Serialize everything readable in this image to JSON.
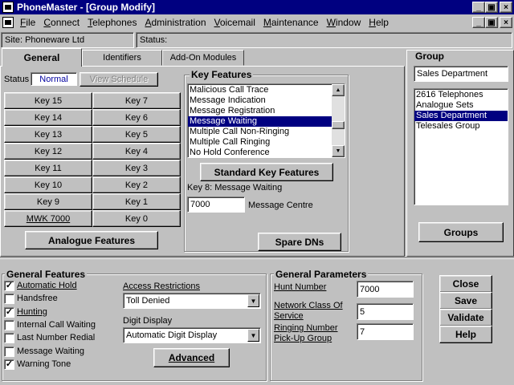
{
  "window": {
    "title": "PhoneMaster - [Group Modify]",
    "app_icon": "phonemaster-app-icon",
    "controls": [
      "_",
      "▫",
      "×"
    ]
  },
  "menu": [
    "File",
    "Connect",
    "Telephones",
    "Administration",
    "Voicemail",
    "Maintenance",
    "Window",
    "Help"
  ],
  "status_bar": {
    "site": "Site: Phoneware Ltd",
    "status": "Status:"
  },
  "tabs": [
    "General",
    "Identifiers",
    "Add-On Modules"
  ],
  "general": {
    "status_label": "Status",
    "status_value": "Normal",
    "view_schedule": "View Schedule",
    "keys_left": [
      "Key 15",
      "Key 14",
      "Key 13",
      "Key 12",
      "Key 11",
      "Key 10",
      "Key 9",
      "MWK 7000"
    ],
    "keys_right": [
      "Key 7",
      "Key 6",
      "Key 5",
      "Key 4",
      "Key 3",
      "Key 2",
      "Key 1",
      "Key 0"
    ],
    "analogue_features": "Analogue Features"
  },
  "key_features": {
    "title": "Key Features",
    "items": [
      "Malicious Call Trace",
      "Message Indication",
      "Message Registration",
      "Message Waiting",
      "Multiple Call Non-Ringing",
      "Multiple Call Ringing",
      "No Hold Conference"
    ],
    "selected": "Message Waiting",
    "standard_button": "Standard Key Features",
    "key_label": "Key 8: Message Waiting",
    "number_value": "7000",
    "number_caption": "Message Centre",
    "spare_dns": "Spare DNs"
  },
  "group": {
    "title": "Group",
    "name_value": "Sales Department",
    "items": [
      "2616 Telephones",
      "Analogue Sets",
      "Sales Department",
      "Telesales Group"
    ],
    "selected": "Sales Department",
    "groups_button": "Groups"
  },
  "general_features": {
    "title": "General Features",
    "checkboxes": [
      {
        "label": "Automatic Hold",
        "checked": true
      },
      {
        "label": "Handsfree",
        "checked": false
      },
      {
        "label": "Hunting",
        "checked": true
      },
      {
        "label": "Internal Call Waiting",
        "checked": false
      },
      {
        "label": "Last Number Redial",
        "checked": false
      },
      {
        "label": "Message Waiting",
        "checked": false
      },
      {
        "label": "Warning Tone",
        "checked": true
      }
    ],
    "access_label": "Access Restrictions",
    "access_value": "Toll Denied",
    "digit_label": "Digit Display",
    "digit_value": "Automatic Digit Display",
    "advanced": "Advanced"
  },
  "general_parameters": {
    "title": "General Parameters",
    "hunt_label": "Hunt Number",
    "hunt_value": "7000",
    "ncos_label_1": "Network Class Of",
    "ncos_label_2": "Service",
    "ncos_value": "5",
    "rnpg_label_1": "Ringing Number",
    "rnpg_label_2": "Pick-Up Group",
    "rnpg_value": "7"
  },
  "actions": [
    "Close",
    "Save",
    "Validate",
    "Help"
  ]
}
